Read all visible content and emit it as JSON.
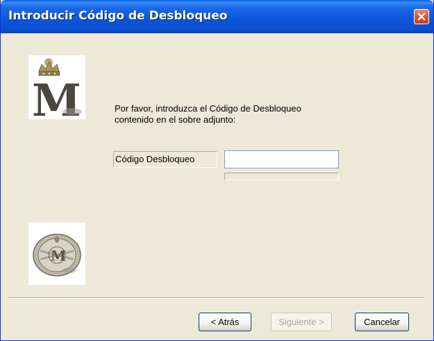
{
  "window": {
    "title": "Introducir Código de Desbloqueo"
  },
  "instruction": {
    "line1": "Por favor, introduzca el Código de Desbloqueo",
    "line2": "contenido en el sobre adjunto:"
  },
  "form": {
    "code_label": "Código Desbloqueo",
    "code_value": "",
    "code_placeholder": ""
  },
  "buttons": {
    "back": "< Atrás",
    "next": "Siguiente >",
    "cancel": "Cancelar"
  },
  "icons": {
    "close": "close-icon",
    "logo_top": "crowned-m-logo",
    "logo_bottom": "coin-seal-logo"
  },
  "colors": {
    "title_bar": "#0B55DA",
    "dialog_background": "#ECE9D8",
    "close_button": "#D9583A",
    "disabled_text": "#ACA899"
  },
  "logos": {
    "top_letter": "M",
    "bottom_letter": "M"
  }
}
